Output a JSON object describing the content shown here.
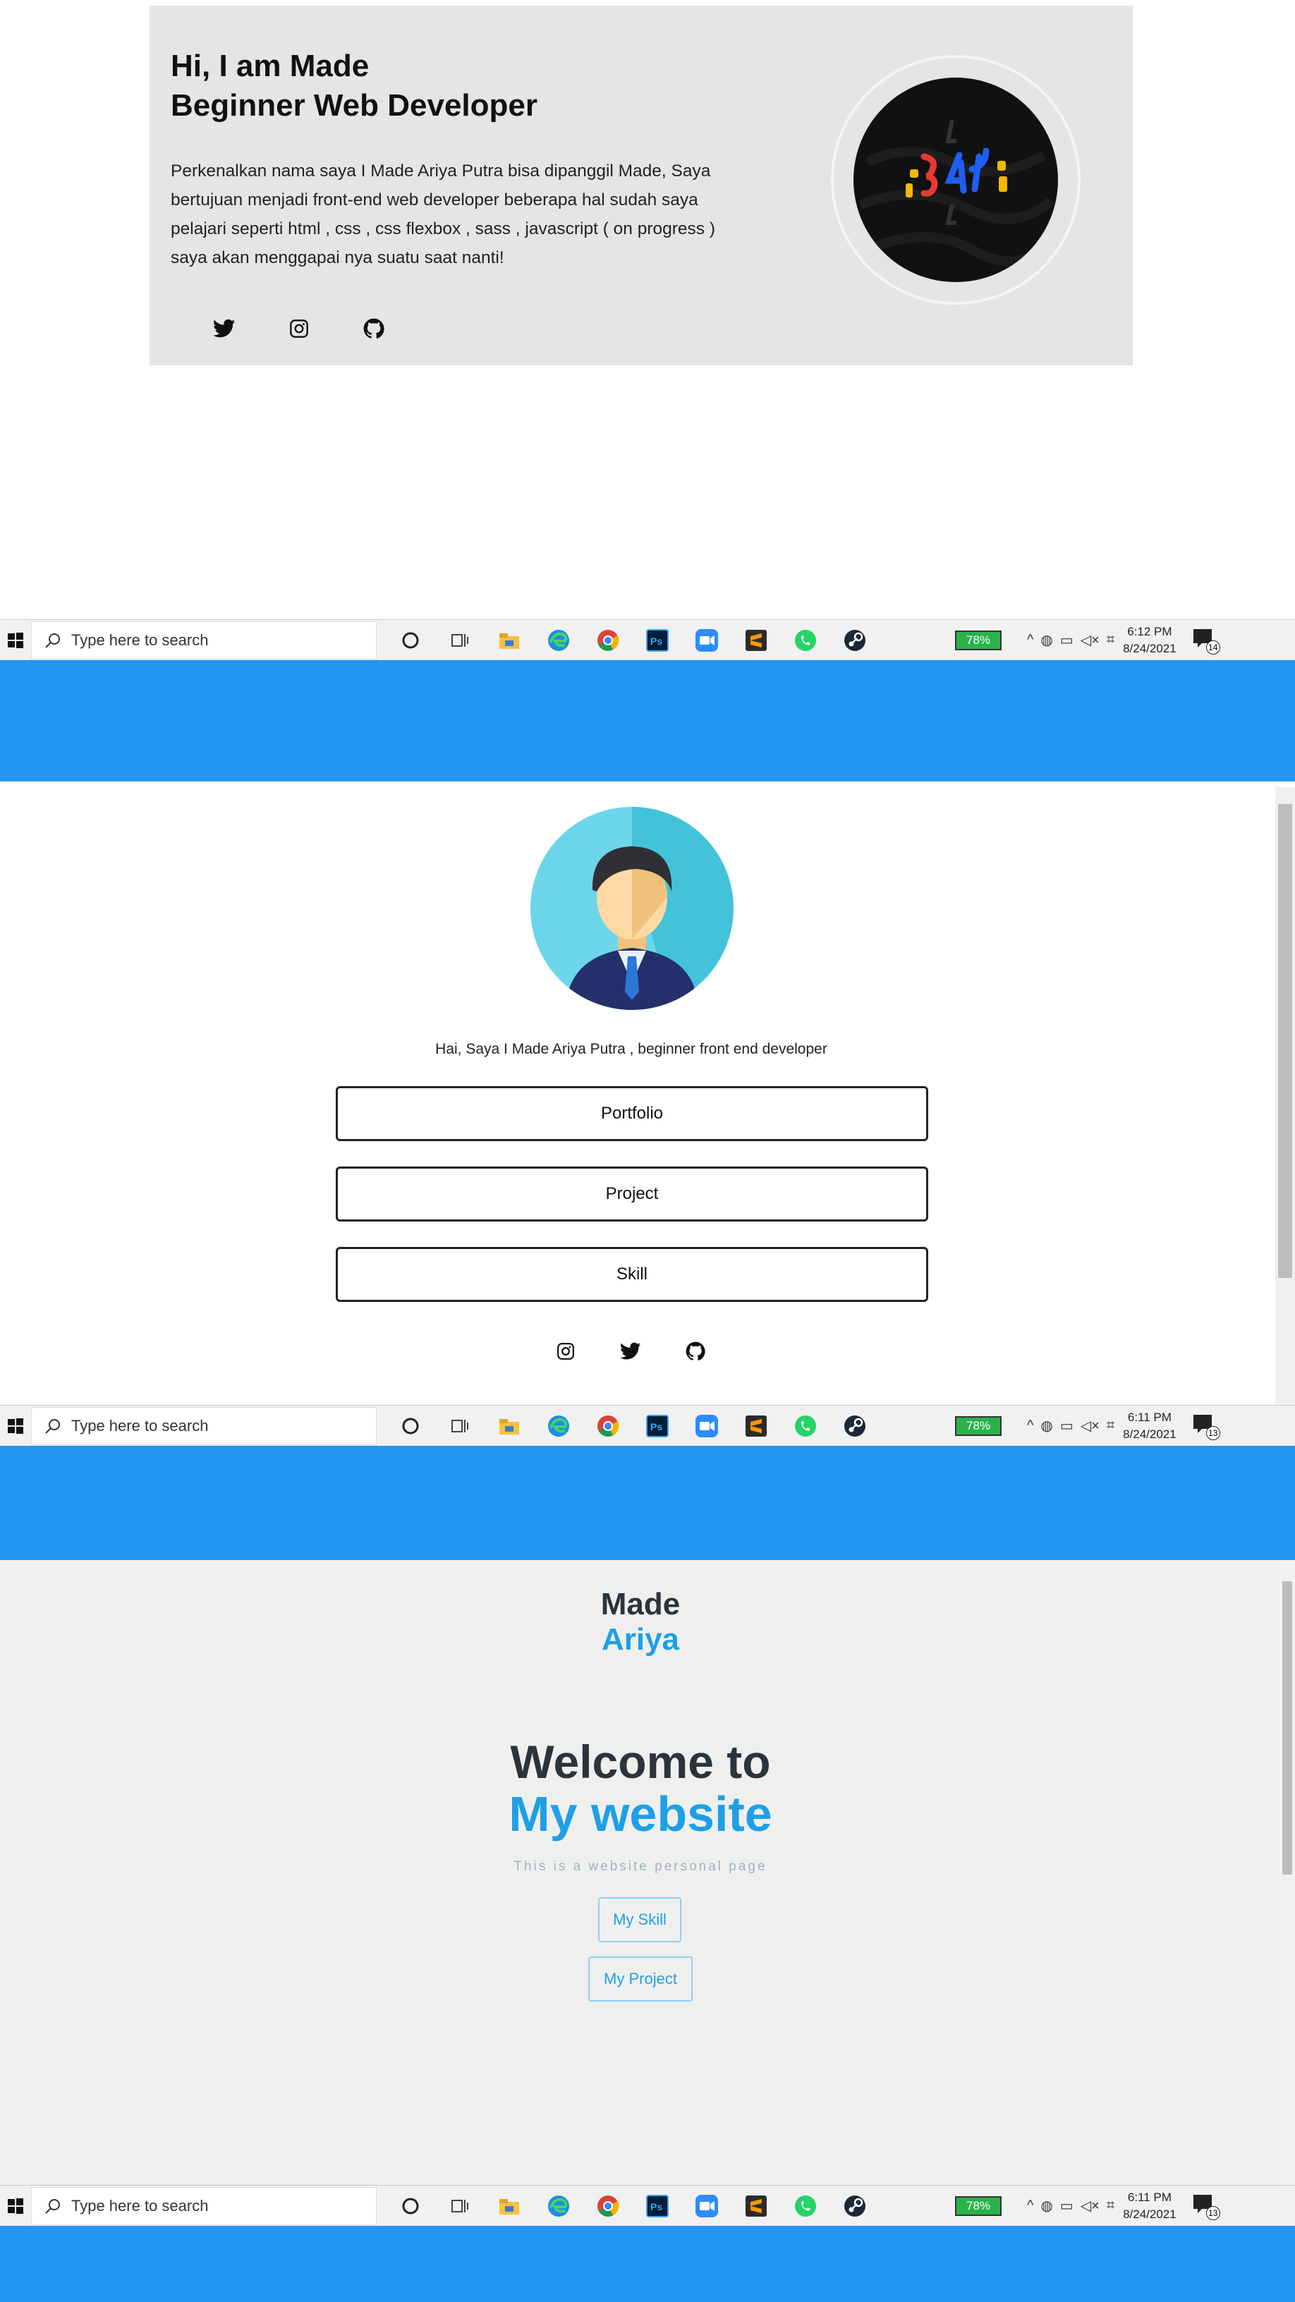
{
  "profile_card": {
    "title_line1": "Hi, I am Made",
    "title_line2": "Beginner Web Developer",
    "description": "Perkenalkan nama saya I Made Ariya Putra bisa dipanggil Made, Saya bertujuan menjadi front-end web developer beberapa hal sudah saya pelajari seperti html , css , css flexbox , sass , javascript ( on progress ) saya akan menggapai nya suatu saat nanti!",
    "socials": [
      "twitter-icon",
      "instagram-icon",
      "github-icon"
    ]
  },
  "taskbars": [
    {
      "search_placeholder": "Type here to search",
      "battery": "78%",
      "time": "6:12 PM",
      "date": "8/24/2021",
      "notifications": "14"
    },
    {
      "search_placeholder": "Type here to search",
      "battery": "78%",
      "time": "6:11 PM",
      "date": "8/24/2021",
      "notifications": "13"
    },
    {
      "search_placeholder": "Type here to search",
      "battery": "78%",
      "time": "6:11 PM",
      "date": "8/24/2021",
      "notifications": "13"
    }
  ],
  "taskbar_apps": [
    "cortana-icon",
    "task-view-icon",
    "file-explorer-icon",
    "edge-icon",
    "chrome-icon",
    "photoshop-icon",
    "zoom-icon",
    "sublime-icon",
    "whatsapp-icon",
    "steam-icon"
  ],
  "link_page": {
    "greeting": "Hai, Saya I Made Ariya Putra , beginner front end developer",
    "buttons": [
      "Portfolio",
      "Project",
      "Skill"
    ],
    "socials": [
      "instagram-icon",
      "twitter-icon",
      "github-icon"
    ]
  },
  "welcome_page": {
    "brand_line1": "Made",
    "brand_line2": "Ariya",
    "heading_line1": "Welcome to",
    "heading_line2": "My website",
    "tagline": "This is a website personal page",
    "cta_skill": "My Skill",
    "cta_project": "My Project"
  },
  "colors": {
    "accent_blue": "#1ea0e6",
    "band_blue": "#2196f3",
    "dark_text": "#2b333b",
    "battery_green": "#2bb24c"
  }
}
